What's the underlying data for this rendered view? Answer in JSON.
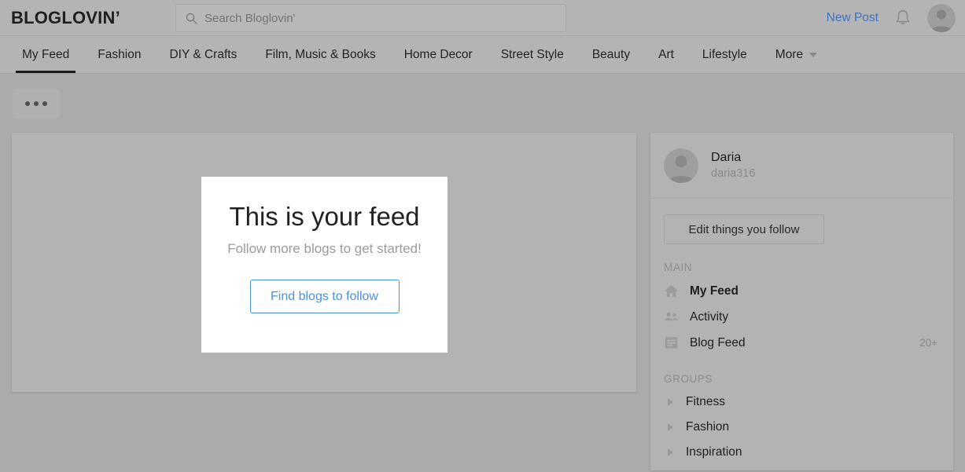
{
  "header": {
    "logo": "BLOGLOVIN’",
    "search": {
      "placeholder": "Search Bloglovin'",
      "value": "",
      "icon": "search-icon"
    },
    "new_post_label": "New Post",
    "notifications_icon": "bell-icon",
    "avatar_icon": "avatar-placeholder-icon"
  },
  "nav": {
    "items": [
      {
        "label": "My Feed",
        "active": true
      },
      {
        "label": "Fashion",
        "active": false
      },
      {
        "label": "DIY & Crafts",
        "active": false
      },
      {
        "label": "Film, Music & Books",
        "active": false
      },
      {
        "label": "Home Decor",
        "active": false
      },
      {
        "label": "Street Style",
        "active": false
      },
      {
        "label": "Beauty",
        "active": false
      },
      {
        "label": "Art",
        "active": false
      },
      {
        "label": "Lifestyle",
        "active": false
      },
      {
        "label": "More",
        "active": false,
        "has_caret": true
      }
    ]
  },
  "toolbar": {
    "more_options_label": "..."
  },
  "feed": {
    "empty_state": {
      "title": "This is your feed",
      "subtitle": "Follow more blogs to get started!",
      "button_label": "Find blogs to follow"
    }
  },
  "sidebar": {
    "profile": {
      "name": "Daria",
      "handle": "daria316",
      "avatar_icon": "avatar-placeholder-icon"
    },
    "edit_button_label": "Edit things you follow",
    "main_section": {
      "label": "MAIN",
      "items": [
        {
          "label": "My Feed",
          "icon": "home-icon",
          "active": true,
          "count": ""
        },
        {
          "label": "Activity",
          "icon": "people-icon",
          "active": false,
          "count": ""
        },
        {
          "label": "Blog Feed",
          "icon": "list-icon",
          "active": false,
          "count": "20+"
        }
      ]
    },
    "groups_section": {
      "label": "GROUPS",
      "items": [
        {
          "label": "Fitness",
          "icon": "chevron-right-icon"
        },
        {
          "label": "Fashion",
          "icon": "chevron-right-icon"
        },
        {
          "label": "Inspiration",
          "icon": "chevron-right-icon"
        }
      ]
    }
  },
  "colors": {
    "accent_link": "#3d72c4",
    "accent_button": "#4a90e2",
    "page_bg": "#ababab",
    "panel_bg": "#b3b3b3",
    "card_bg": "#ffffff"
  }
}
